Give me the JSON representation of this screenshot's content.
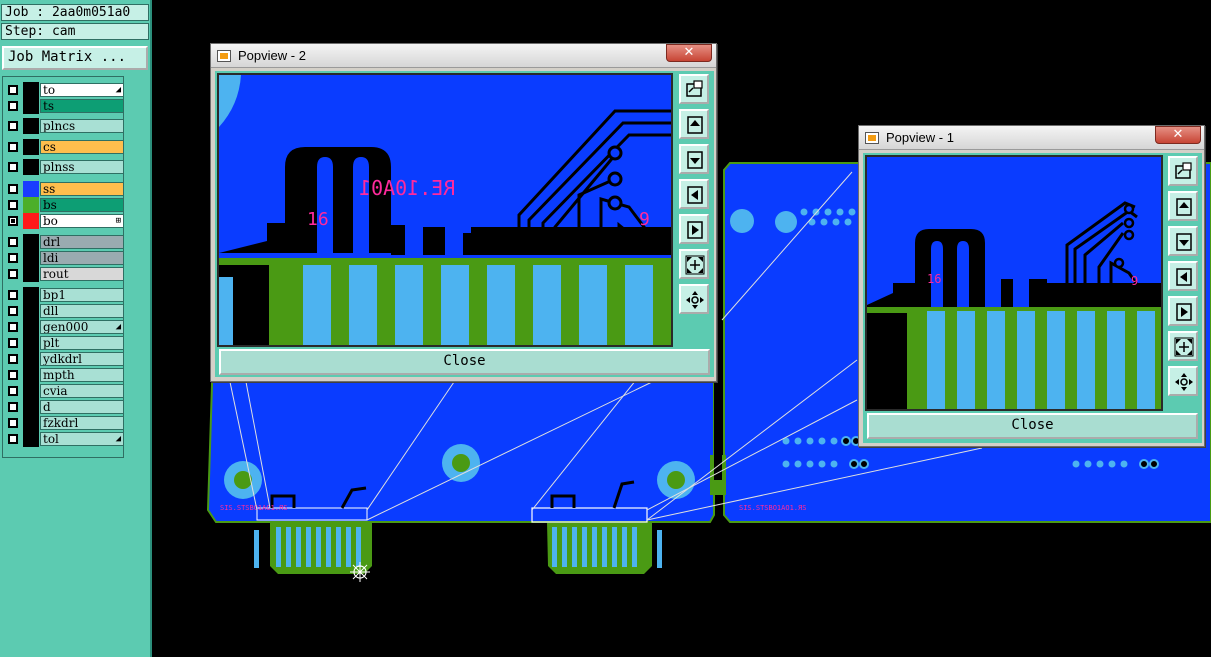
{
  "side_panel": {
    "job_line": "Job : 2aa0m051a0",
    "step_line": "Step: cam",
    "job_matrix_label": "Job Matrix ...",
    "layers": [
      {
        "name": "to",
        "bg": "#ffffff",
        "swatch": "#000000",
        "marker": "◢"
      },
      {
        "name": "ts",
        "bg": "#0d9e74",
        "swatch": "#000000",
        "marker": ""
      },
      {
        "name": "plncs",
        "bg": "#a8e0d4",
        "swatch": "#000000",
        "marker": ""
      },
      {
        "name": "cs",
        "bg": "#ffbe4d",
        "swatch": "#000000",
        "marker": ""
      },
      {
        "name": "plnss",
        "bg": "#a8e0d4",
        "swatch": "#000000",
        "marker": ""
      },
      {
        "name": "ss",
        "bg": "#ffbe4d",
        "swatch": "#1a3cff",
        "marker": ""
      },
      {
        "name": "bs",
        "bg": "#0d9e74",
        "swatch": "#4caf2a",
        "marker": ""
      },
      {
        "name": "bo",
        "bg": "#ffffff",
        "swatch": "#ff1a1a",
        "marker": "⊞",
        "checked": true
      },
      {
        "name": "drl",
        "bg": "#9aabb0",
        "swatch": "#000000",
        "marker": ""
      },
      {
        "name": "ldi",
        "bg": "#9aabb0",
        "swatch": "#000000",
        "marker": ""
      },
      {
        "name": "rout",
        "bg": "#d8d8d8",
        "swatch": "#000000",
        "marker": ""
      },
      {
        "name": "bp1",
        "bg": "#a8e0d4",
        "swatch": "#000000",
        "marker": ""
      },
      {
        "name": "dll",
        "bg": "#a8e0d4",
        "swatch": "#000000",
        "marker": ""
      },
      {
        "name": "gen000",
        "bg": "#a8e0d4",
        "swatch": "#000000",
        "marker": "◢"
      },
      {
        "name": "plt",
        "bg": "#a8e0d4",
        "swatch": "#000000",
        "marker": ""
      },
      {
        "name": "ydkdrl",
        "bg": "#a8e0d4",
        "swatch": "#000000",
        "marker": ""
      },
      {
        "name": "mpth",
        "bg": "#a8e0d4",
        "swatch": "#000000",
        "marker": ""
      },
      {
        "name": "cvia",
        "bg": "#a8e0d4",
        "swatch": "#000000",
        "marker": ""
      },
      {
        "name": "d",
        "bg": "#a8e0d4",
        "swatch": "#000000",
        "marker": ""
      },
      {
        "name": "fzkdrl",
        "bg": "#a8e0d4",
        "swatch": "#000000",
        "marker": ""
      },
      {
        "name": "tol",
        "bg": "#a8e0d4",
        "swatch": "#000000",
        "marker": "◢"
      }
    ]
  },
  "canvas": {
    "board_text_left": "SIS.STSBO1AO1.ЯS",
    "board_text_right": "SIS.STSBO1AO1.ЯS"
  },
  "popviews": [
    {
      "title": "Popview - 2",
      "close_label": "Close",
      "close_x": "✕",
      "mirrored_label": "RE.10A01",
      "pad_label_left": "16",
      "pad_label_right": "9"
    },
    {
      "title": "Popview - 1",
      "close_label": "Close",
      "close_x": "✕",
      "pad_label_left": "16",
      "pad_label_right": "9"
    }
  ],
  "tool_icons": [
    "zoom-home-icon",
    "pan-up-icon",
    "pan-down-icon",
    "pan-left-icon",
    "pan-right-icon",
    "fit-screen-icon",
    "move-icon"
  ],
  "colors": {
    "board_blue": "#0a3cff",
    "copper_green": "#4a9a14",
    "pad_light_blue": "#4db3f0",
    "panel_teal": "#5ccbb1",
    "text_magenta": "#ff2a9d"
  }
}
